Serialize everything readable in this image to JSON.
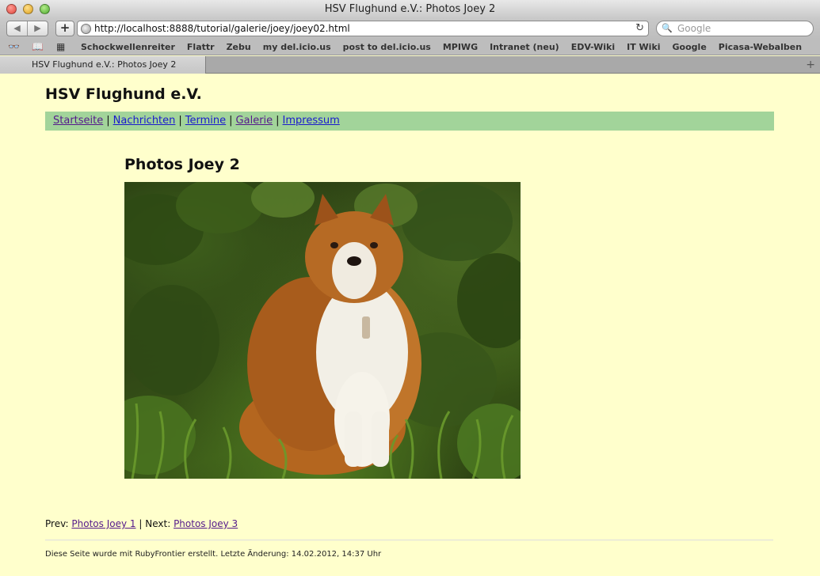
{
  "window": {
    "title": "HSV Flughund e.V.: Photos Joey 2"
  },
  "toolbar": {
    "back_label": "◀",
    "forward_label": "▶",
    "add_label": "+",
    "url": "http://localhost:8888/tutorial/galerie/joey/joey02.html",
    "reload_label": "↻",
    "search_icon": "🔍",
    "search_placeholder": "Google"
  },
  "bookmarks": {
    "reading_list_icon": "👓",
    "bookmarks_icon": "📖",
    "top_sites_icon": "▦",
    "items": [
      "Schockwellenreiter",
      "Flattr",
      "Zebu",
      "my del.icio.us",
      "post to del.icio.us",
      "MPIWG",
      "Intranet (neu)",
      "EDV-Wiki",
      "IT Wiki",
      "Google",
      "Picasa-Webalben"
    ]
  },
  "tabs": [
    {
      "label": "HSV Flughund e.V.: Photos Joey 2"
    }
  ],
  "new_tab_label": "+",
  "page": {
    "site_title": "HSV Flughund e.V.",
    "nav": [
      {
        "label": "Startseite",
        "visited": true
      },
      {
        "label": "Nachrichten",
        "visited": false
      },
      {
        "label": "Termine",
        "visited": false
      },
      {
        "label": "Galerie",
        "visited": true
      },
      {
        "label": "Impressum",
        "visited": false
      }
    ],
    "nav_separator": "|",
    "heading": "Photos Joey 2",
    "footer_nav": {
      "prev_label": "Prev:",
      "prev_link": "Photos Joey 1",
      "separator": "|",
      "next_label": "Next:",
      "next_link": "Photos Joey 3"
    },
    "footer_text": "Diese Seite wurde mit RubyFrontier erstellt. Letzte Änderung: 14.02.2012, 14:37 Uhr"
  },
  "colors": {
    "page_background": "#ffffcc",
    "nav_background": "#a2d49a",
    "link": "#1a1acc",
    "visited_link": "#551a8b"
  }
}
